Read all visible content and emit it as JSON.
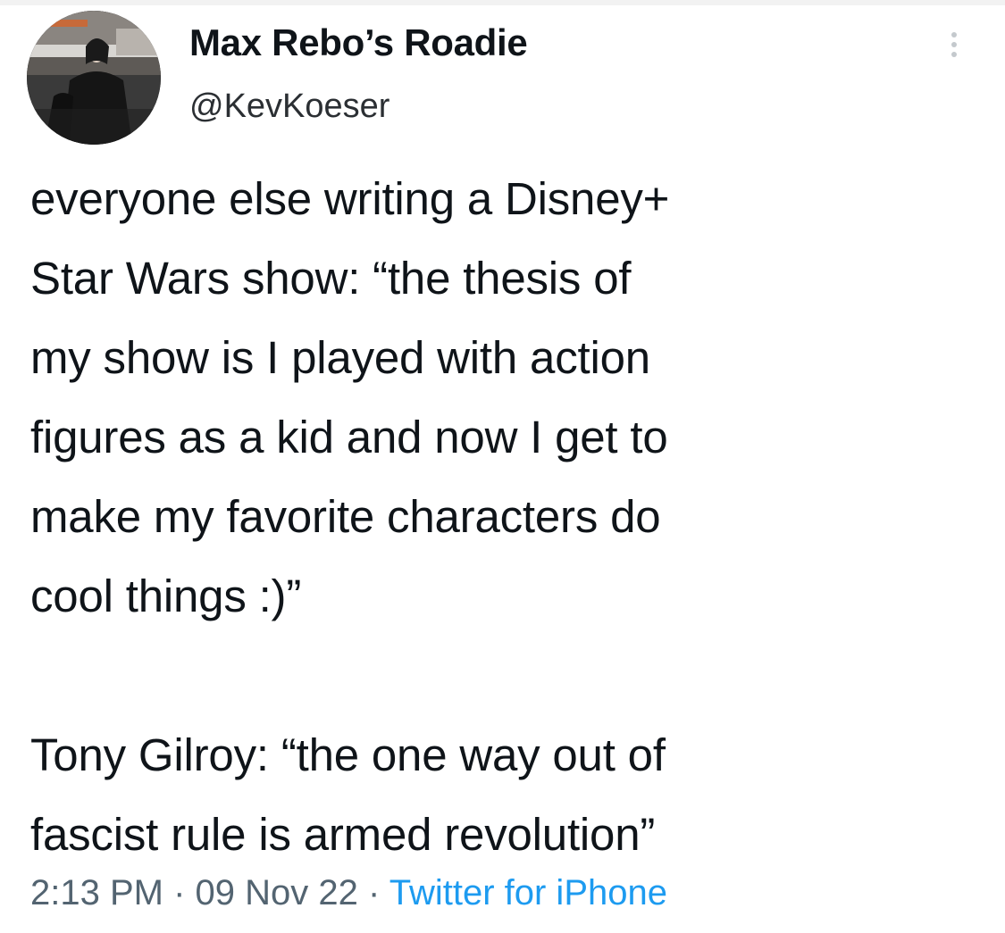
{
  "tweet": {
    "display_name": "Max Rebo’s Roadie",
    "handle": "@KevKoeser",
    "body_lines": [
      "everyone else writing a Disney+",
      "Star Wars show: “the thesis of",
      "my show is I played with action",
      "figures as a kid and now I get to",
      "make my favorite characters do",
      "cool things :)”",
      "",
      "Tony Gilroy: “the one way out of",
      "fascist rule is armed revolution”"
    ],
    "time": "2:13 PM",
    "separator": "·",
    "date": "09 Nov 22",
    "source": "Twitter for iPhone"
  },
  "colors": {
    "text": "#0f1419",
    "meta": "#536471",
    "link": "#1d9bf0"
  },
  "icons": {
    "more": "more-vertical-icon",
    "avatar": "avatar-image"
  }
}
